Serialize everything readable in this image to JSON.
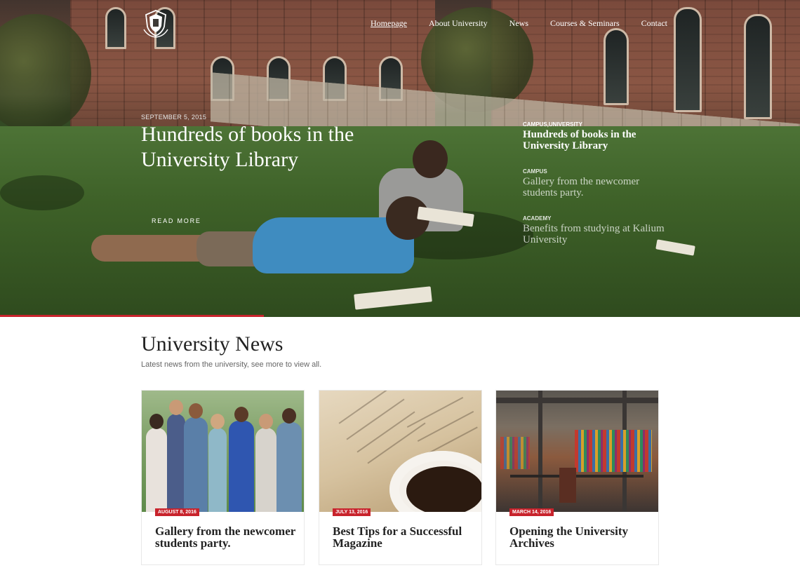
{
  "nav": {
    "items": [
      {
        "label": "Homepage",
        "active": true
      },
      {
        "label": "About University",
        "active": false
      },
      {
        "label": "News",
        "active": false
      },
      {
        "label": "Courses & Seminars",
        "active": false
      },
      {
        "label": "Contact",
        "active": false
      }
    ]
  },
  "hero": {
    "date": "SEPTEMBER 5, 2015",
    "title": "Hundreds of books in the University Library",
    "read_more": "READ MORE",
    "slider_progress_percent": 33,
    "side_items": [
      {
        "category": "CAMPUS,UNIVERSITY",
        "title": "Hundreds of books in the University Library",
        "active": true
      },
      {
        "category": "CAMPUS",
        "title": "Gallery from the newcomer students party.",
        "active": false
      },
      {
        "category": "ACADEMY",
        "title": "Benefits from studying at Kalium University",
        "active": false
      }
    ]
  },
  "news": {
    "title": "University News",
    "subtitle": "Latest news from the university, see more to view all.",
    "cards": [
      {
        "date": "AUGUST 8, 2016",
        "title": "Gallery from the newcomer students party."
      },
      {
        "date": "JULY 13, 2016",
        "title": "Best Tips for a Successful Magazine"
      },
      {
        "date": "MARCH 14, 2016",
        "title": "Opening the University Archives"
      }
    ]
  },
  "colors": {
    "accent": "#c8232c",
    "text_dark": "#222222",
    "text_muted": "#666666"
  },
  "icons": {
    "logo": "university-crest-icon"
  }
}
